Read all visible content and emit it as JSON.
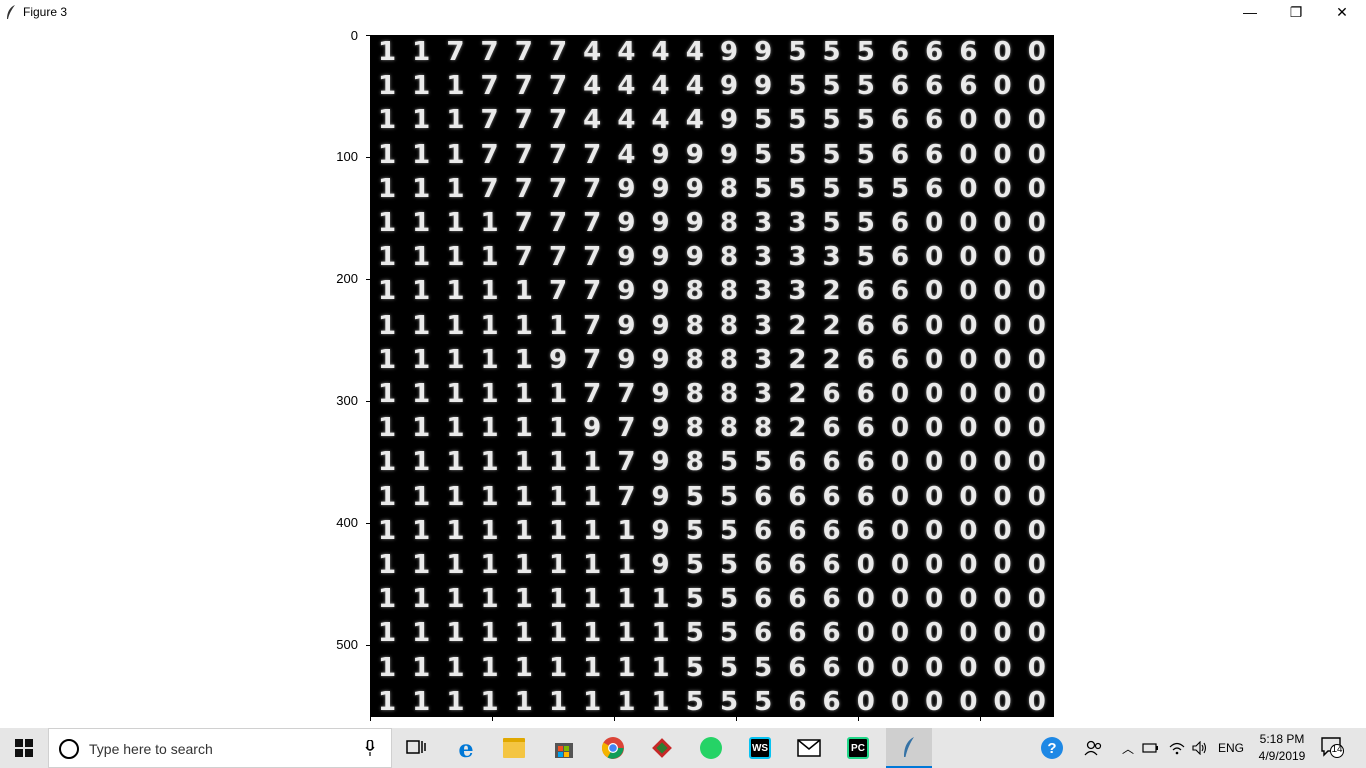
{
  "window": {
    "title": "Figure 3",
    "minimize_glyph": "—",
    "maximize_glyph": "❐",
    "close_glyph": "✕"
  },
  "plot": {
    "y_ticks": [
      "0",
      "100",
      "200",
      "300",
      "400",
      "500"
    ],
    "grid_rows": [
      "1 1 7 7 7 7 4 4 4 4 9 9 5 5 5 6 6 6 0 0",
      "1 1 1 7 7 7 4 4 4 4 9 9 5 5 5 6 6 6 0 0",
      "1 1 1 7 7 7 4 4 4 4 9 5 5 5 5 6 6 0 0 0",
      "1 1 1 7 7 7 7 4 9 9 9 5 5 5 5 6 6 0 0 0",
      "1 1 1 7 7 7 7 9 9 9 8 5 5 5 5 5 6 0 0 0",
      "1 1 1 1 7 7 7 9 9 9 8 3 3 5 5 6 0 0 0 0",
      "1 1 1 1 7 7 7 9 9 9 8 3 3 3 5 6 0 0 0 0",
      "1 1 1 1 1 7 7 9 9 8 8 3 3 2 6 6 0 0 0 0",
      "1 1 1 1 1 1 7 9 9 8 8 3 2 2 6 6 0 0 0 0",
      "1 1 1 1 1 9 7 9 9 8 8 3 2 2 6 6 0 0 0 0",
      "1 1 1 1 1 1 7 7 9 8 8 3 2 6 6 0 0 0 0 0",
      "1 1 1 1 1 1 9 7 9 8 8 8 2 6 6 0 0 0 0 0",
      "1 1 1 1 1 1 1 7 9 8 5 5 6 6 6 0 0 0 0 0",
      "1 1 1 1 1 1 1 7 9 5 5 6 6 6 6 0 0 0 0 0",
      "1 1 1 1 1 1 1 1 9 5 5 6 6 6 6 0 0 0 0 0",
      "1 1 1 1 1 1 1 1 9 5 5 6 6 6 0 0 0 0 0 0",
      "1 1 1 1 1 1 1 1 1 5 5 6 6 6 0 0 0 0 0 0",
      "1 1 1 1 1 1 1 1 1 5 5 6 6 6 0 0 0 0 0 0",
      "1 1 1 1 1 1 1 1 1 5 5 5 6 6 0 0 0 0 0 0",
      "1 1 1 1 1 1 1 1 1 5 5 5 6 6 0 0 0 0 0 0"
    ]
  },
  "taskbar": {
    "search_placeholder": "Type here to search",
    "apps": [
      {
        "name": "task-view",
        "label": "",
        "color": "#000000"
      },
      {
        "name": "edge",
        "label": "e",
        "color": "#0078d7"
      },
      {
        "name": "file-explorer",
        "label": "",
        "color": "#f4c542"
      },
      {
        "name": "store",
        "label": "",
        "color": "#555555"
      },
      {
        "name": "chrome",
        "label": "",
        "color": "#db4437"
      },
      {
        "name": "git",
        "label": "",
        "color": "#2e7d32"
      },
      {
        "name": "whatsapp",
        "label": "",
        "color": "#25d366"
      },
      {
        "name": "webstorm",
        "label": "WS",
        "color": "#07c3f2"
      },
      {
        "name": "mail",
        "label": "",
        "color": "#333333"
      },
      {
        "name": "pycharm",
        "label": "PC",
        "color": "#21d789"
      },
      {
        "name": "python-figure",
        "label": "",
        "color": "#3572a5"
      }
    ],
    "tray": {
      "language": "ENG",
      "time": "5:18 PM",
      "date": "4/9/2019",
      "notification_count": "14"
    }
  }
}
